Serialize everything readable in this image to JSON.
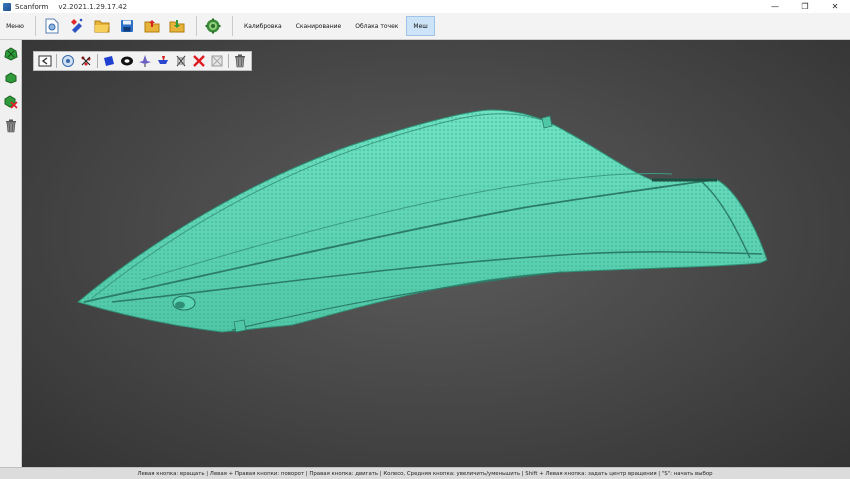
{
  "window": {
    "title": "Scanform",
    "version": "v2.2021.1.29.17.42",
    "controls": {
      "minimize": "—",
      "restore": "❐",
      "close": "✕"
    }
  },
  "toolbar": {
    "menu_label": "Меню",
    "icons": [
      "document-icon",
      "wand-icon",
      "folder-open-icon",
      "save-icon",
      "folder-export-icon",
      "folder-import-icon",
      "settings-gear-icon"
    ],
    "tabs": [
      {
        "label": "Калибровка",
        "active": false
      },
      {
        "label": "Сканирование",
        "active": false
      },
      {
        "label": "Облака точек",
        "active": false
      },
      {
        "label": "Меш",
        "active": true
      }
    ]
  },
  "sidebar": {
    "icons": [
      "mesh-add-icon",
      "mesh-fill-icon",
      "mesh-remove-icon",
      "trash-icon"
    ]
  },
  "view_tools": {
    "icons": [
      "exit-view-icon",
      "zoom-fit-icon",
      "select-points-icon",
      "select-blue-icon",
      "lasso-icon",
      "flatten-icon",
      "section-icon",
      "invert-selection-icon",
      "delete-selection-icon",
      "clear-selection-icon",
      "trash-icon"
    ]
  },
  "colors": {
    "mesh": "#5ad6b4",
    "viewport_bg": "#4a4a4a",
    "active_tab": "#cde3f7"
  },
  "statusbar": {
    "text": "Левая кнопка: вращать  |  Левая + Правая кнопки: поворот  |  Правая кнопка: двигать  |  Колесо, Средняя кнопка: увеличить/уменьшить  |  Shift + Левая кнопка: задать центр вращения  |  \"S\": начать выбор"
  }
}
